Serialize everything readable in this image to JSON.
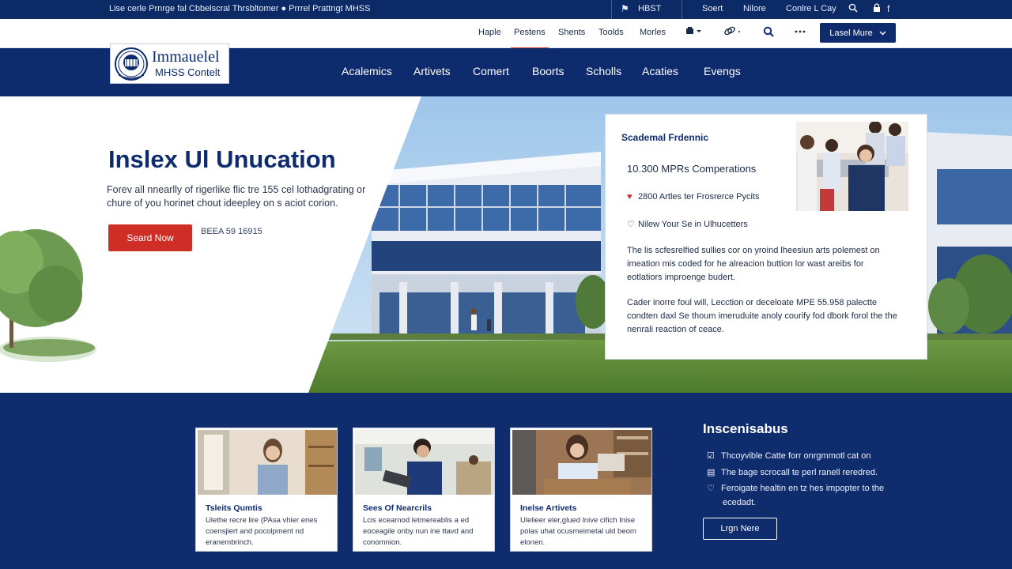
{
  "top_bar": {
    "tagline": "Lise cerle Prnrge fal Cbbelscral Thrsbltomer",
    "tagline_tail": "Prrrel Prattngt MHSS",
    "items": [
      "HBST",
      "Soert",
      "Nilore",
      "Conlre L Cay"
    ],
    "icons": [
      "flag-icon",
      "search-icon",
      "lock-icon",
      "facebook-icon"
    ]
  },
  "secondary_nav": {
    "items": [
      "Haple",
      "Pestens",
      "Shents",
      "Toolds",
      "Morles"
    ],
    "active": "Pestens",
    "cta_label": "Lasel Mure"
  },
  "logo": {
    "line1": "Immauelel",
    "line2": "MHSS Contelt"
  },
  "main_nav": {
    "items": [
      "Acalemics",
      "Artivets",
      "Comert",
      "Boorts",
      "Scholls",
      "Acaties",
      "Evengs"
    ]
  },
  "hero": {
    "title": "Inslex Ul Unucation",
    "subtitle": "Forev all nnearlly of rigerlike flic tre 155 cel lothadgrating or chure of you horinet chout ideepley on s aciot corion.",
    "button_label": "Seard Now",
    "code": "BEEA 59 16915"
  },
  "info_card": {
    "title": "Scademal Frdennic",
    "stat": "10.300 MPRs Comperations",
    "row1": "2800 Artles ter Frosrerce Pycits",
    "row2": "Nilew Your Se in Ulhucetters",
    "para1": "The lis scfesrelfied sullies cor on yroind lheesiun arts polemest on imeation mis coded for he alreacion buttion lor wast areibs for eotlatiors improenge budert.",
    "para2": "Cader inorre foul will, Lecction or deceloate MPE 55.958 palectte condten daxl Se thoum imeruduite anoly courify fod dbork forol the the nenrali reaction of ceace."
  },
  "feature_cards": [
    {
      "title": "Tsleits Qumtis",
      "text": "Ulethe recre lire (PAsa vhier eries coensjiert and pocolpment nd eranembrinch."
    },
    {
      "title": "Sees Of Nearcrils",
      "text": "Lcis ecearnod letmereablis a ed eoceagile onby nun ine ttavd and conomnion."
    },
    {
      "title": "Inelse Artivets",
      "text": "Ulelieer eler,glued lnive cifich Inise polas uhat ocusmeimetal uld beom elonen."
    }
  ],
  "inside_section": {
    "title": "Inscenisabus",
    "row1": "Thcoyvible Catte forr onrgmmotl cat on",
    "row2": "The bage scrocall te perl ranell reredred.",
    "row3a": "Feroigate healtin en tz hes impopter to the",
    "row3b": "ecedadt.",
    "button_label": "Lrgn Nere"
  },
  "colors": {
    "navy": "#0e2b6e",
    "accent_red": "#cf2e26",
    "white": "#ffffff"
  }
}
